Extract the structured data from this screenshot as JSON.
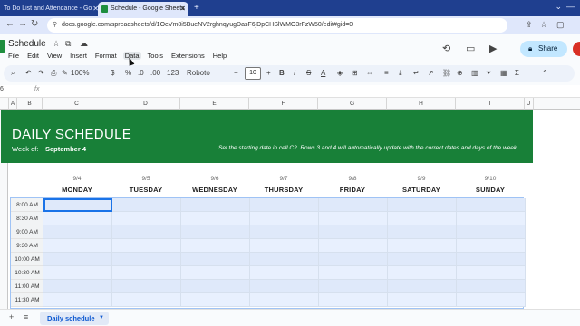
{
  "browser": {
    "tabs": [
      {
        "label": "To Do List and Attendance - Go",
        "active": false
      },
      {
        "label": "Schedule - Google Sheets",
        "active": true
      }
    ],
    "new_tab": "+",
    "url": "docs.google.com/spreadsheets/d/1OeVm8i5BueNV2rghnqyugDasF6jDpCHSlWMO3rFzW50/edit#gid=0"
  },
  "doc": {
    "title": "Schedule",
    "menu": [
      "File",
      "Edit",
      "View",
      "Insert",
      "Format",
      "Data",
      "Tools",
      "Extensions",
      "Help"
    ],
    "share_label": "Share"
  },
  "toolbar": {
    "zoom": "100%",
    "currency": "$",
    "percent": "%",
    "dec_less": ".0",
    "dec_more": ".00",
    "number_format": "123",
    "font": "Roboto",
    "font_size": "10"
  },
  "formula_bar": {
    "name_box": "6",
    "fx": "fx"
  },
  "columns": [
    "A",
    "B",
    "C",
    "D",
    "E",
    "F",
    "G",
    "H",
    "I",
    "J"
  ],
  "schedule": {
    "title": "DAILY SCHEDULE",
    "week_of_label": "Week of:",
    "week_of_value": "September 4",
    "note": "Set the starting date in cell C2. Rows 3 and 4 will automatically update with the correct dates and days of the week.",
    "days": [
      {
        "date": "9/4",
        "name": "MONDAY"
      },
      {
        "date": "9/5",
        "name": "TUESDAY"
      },
      {
        "date": "9/6",
        "name": "WEDNESDAY"
      },
      {
        "date": "9/7",
        "name": "THURSDAY"
      },
      {
        "date": "9/8",
        "name": "FRIDAY"
      },
      {
        "date": "9/9",
        "name": "SATURDAY"
      },
      {
        "date": "9/10",
        "name": "SUNDAY"
      }
    ],
    "times": [
      "8:00 AM",
      "8:30 AM",
      "9:00 AM",
      "9:30 AM",
      "10:00 AM",
      "10:30 AM",
      "11:00 AM",
      "11:30 AM"
    ]
  },
  "sheets": [
    {
      "label": "Daily schedule",
      "active": true
    }
  ],
  "colors": {
    "banner": "#188038",
    "selection": "#1a73e8",
    "share_bg": "#c2e7ff"
  }
}
